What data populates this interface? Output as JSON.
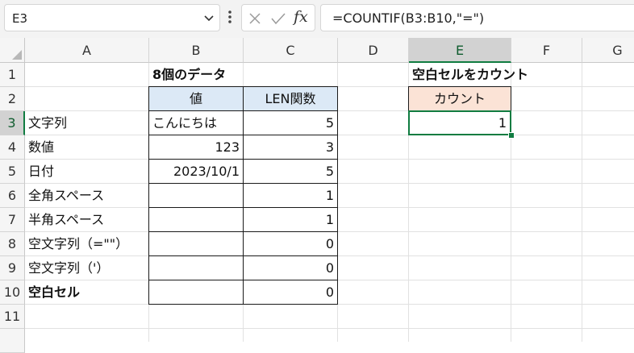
{
  "formula_bar": {
    "name_box": "E3",
    "formula": "=COUNTIF(B3:B10,\"=\")",
    "cancel_icon": "close-icon",
    "enter_icon": "check-icon",
    "fx_label": "fx"
  },
  "columns": [
    "A",
    "B",
    "C",
    "D",
    "E",
    "F",
    "G"
  ],
  "rows": [
    "1",
    "2",
    "3",
    "4",
    "5",
    "6",
    "7",
    "8",
    "9",
    "10",
    "11"
  ],
  "colors": {
    "value_header_bg": "#dce9f6",
    "count_header_bg": "#fbe3d6",
    "selection": "#107c41"
  },
  "cells": {
    "B1": "8個のデータ",
    "E1": "空白セルをカウント",
    "B2": "値",
    "C2": "LEN関数",
    "E2": "カウント",
    "E3": "1",
    "labels": [
      "文字列",
      "数値",
      "日付",
      "全角スペース",
      "半角スペース",
      "空文字列（=\"\"）",
      "空文字列（'）",
      "空白セル"
    ],
    "values": [
      "こんにちは",
      "123",
      "2023/10/1",
      "",
      "",
      "",
      "",
      ""
    ],
    "len": [
      "5",
      "3",
      "5",
      "1",
      "1",
      "0",
      "0",
      "0"
    ]
  }
}
